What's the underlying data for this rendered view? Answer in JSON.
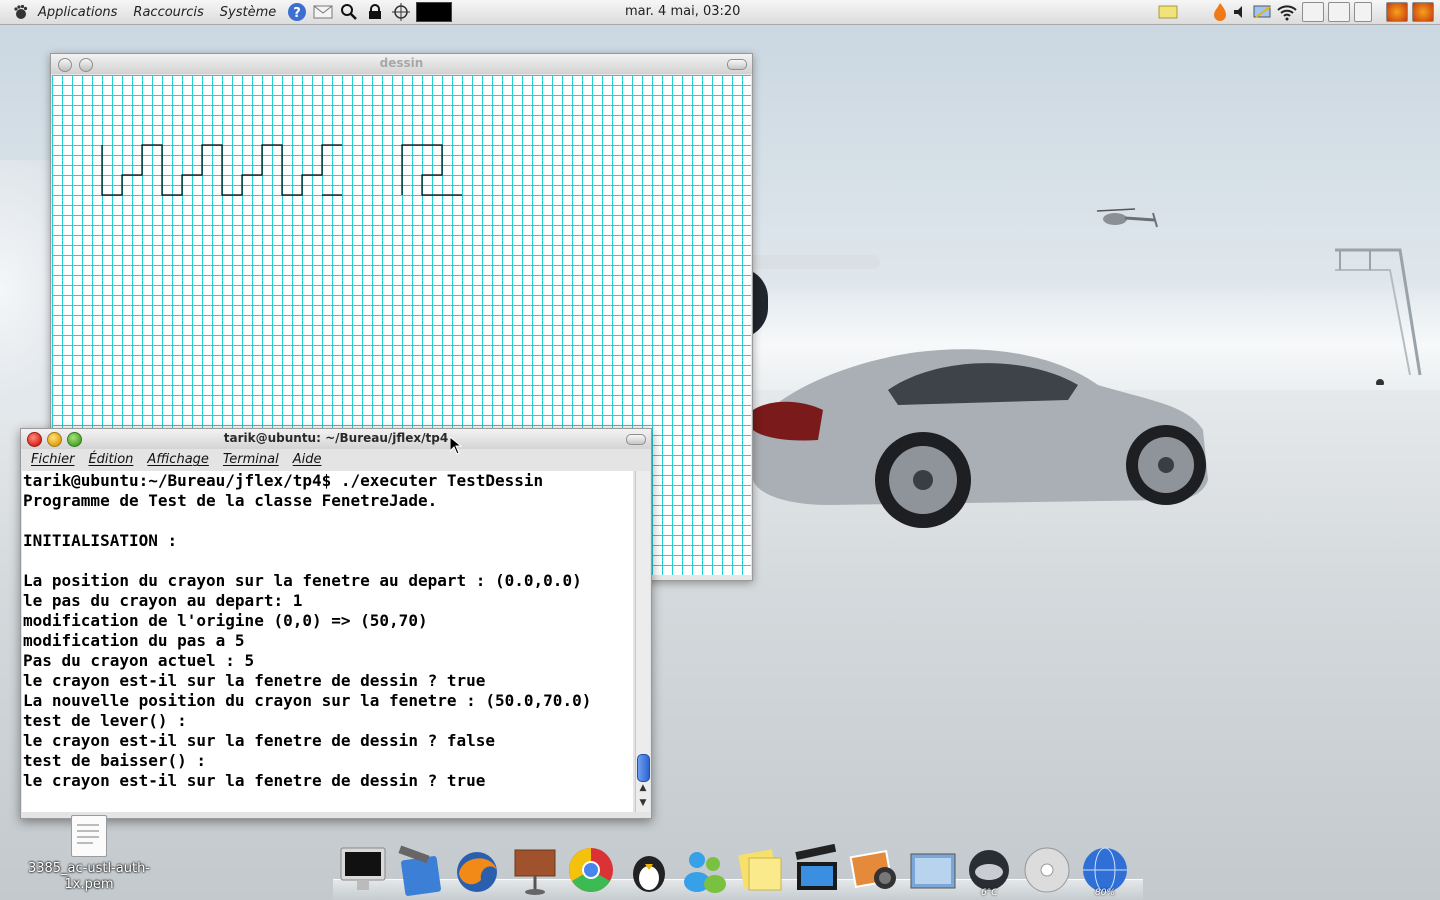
{
  "top_panel": {
    "menus": [
      "Applications",
      "Raccourcis",
      "Système"
    ],
    "clock": "mar.  4 mai, 03:20",
    "launcher_icons": [
      "help-icon",
      "mail-icon",
      "search-icon",
      "lock-icon",
      "crosshair-icon",
      "monitor-icon"
    ],
    "tray_icons": [
      "notes-icon",
      "flame-icon",
      "volume-icon",
      "network-icon",
      "wifi-icon",
      "window-list-icon",
      "window-list-icon",
      "restore-icon",
      "firefox-icon",
      "firefox-icon"
    ]
  },
  "dessin_window": {
    "title": "dessin"
  },
  "terminal": {
    "title": "tarik@ubuntu: ~/Bureau/jflex/tp4",
    "menus": [
      "Fichier",
      "Édition",
      "Affichage",
      "Terminal",
      "Aide"
    ],
    "lines": [
      "tarik@ubuntu:~/Bureau/jflex/tp4$ ./executer TestDessin",
      "Programme de Test de la classe FenetreJade.",
      "",
      "INITIALISATION :",
      "",
      "La position du crayon sur la fenetre au depart : (0.0,0.0)",
      "le pas du crayon au depart: 1",
      "modification de l'origine (0,0) => (50,70)",
      "modification du pas a 5",
      "Pas du crayon actuel : 5",
      "le crayon est-il sur la fenetre de dessin ? true",
      "La nouvelle position du crayon sur la fenetre : (50.0,70.0)",
      "test de lever() :",
      "le crayon est-il sur la fenetre de dessin ? false",
      "test de baisser() :",
      "le crayon est-il sur la fenetre de dessin ? true"
    ]
  },
  "desktop": {
    "file_label": "3385_ac-ustl-auth-1x.pem"
  },
  "dock": {
    "weather_text": "6°C",
    "network_percent": "80%",
    "items": [
      "imac-icon",
      "xcode-icon",
      "firefox-icon",
      "keynote-icon",
      "chrome-icon",
      "pidgin-icon",
      "messenger-icon",
      "stickies-icon",
      "clapper-icon",
      "iphoto-icon",
      "preview-icon",
      "weather-icon",
      "dvd-icon",
      "network-globe-icon"
    ]
  },
  "colors": {
    "grid": "#22cfd6",
    "panel": "#e8e8e8",
    "terminal_bg": "#ffffff",
    "scroll_thumb": "#2d64d1"
  }
}
